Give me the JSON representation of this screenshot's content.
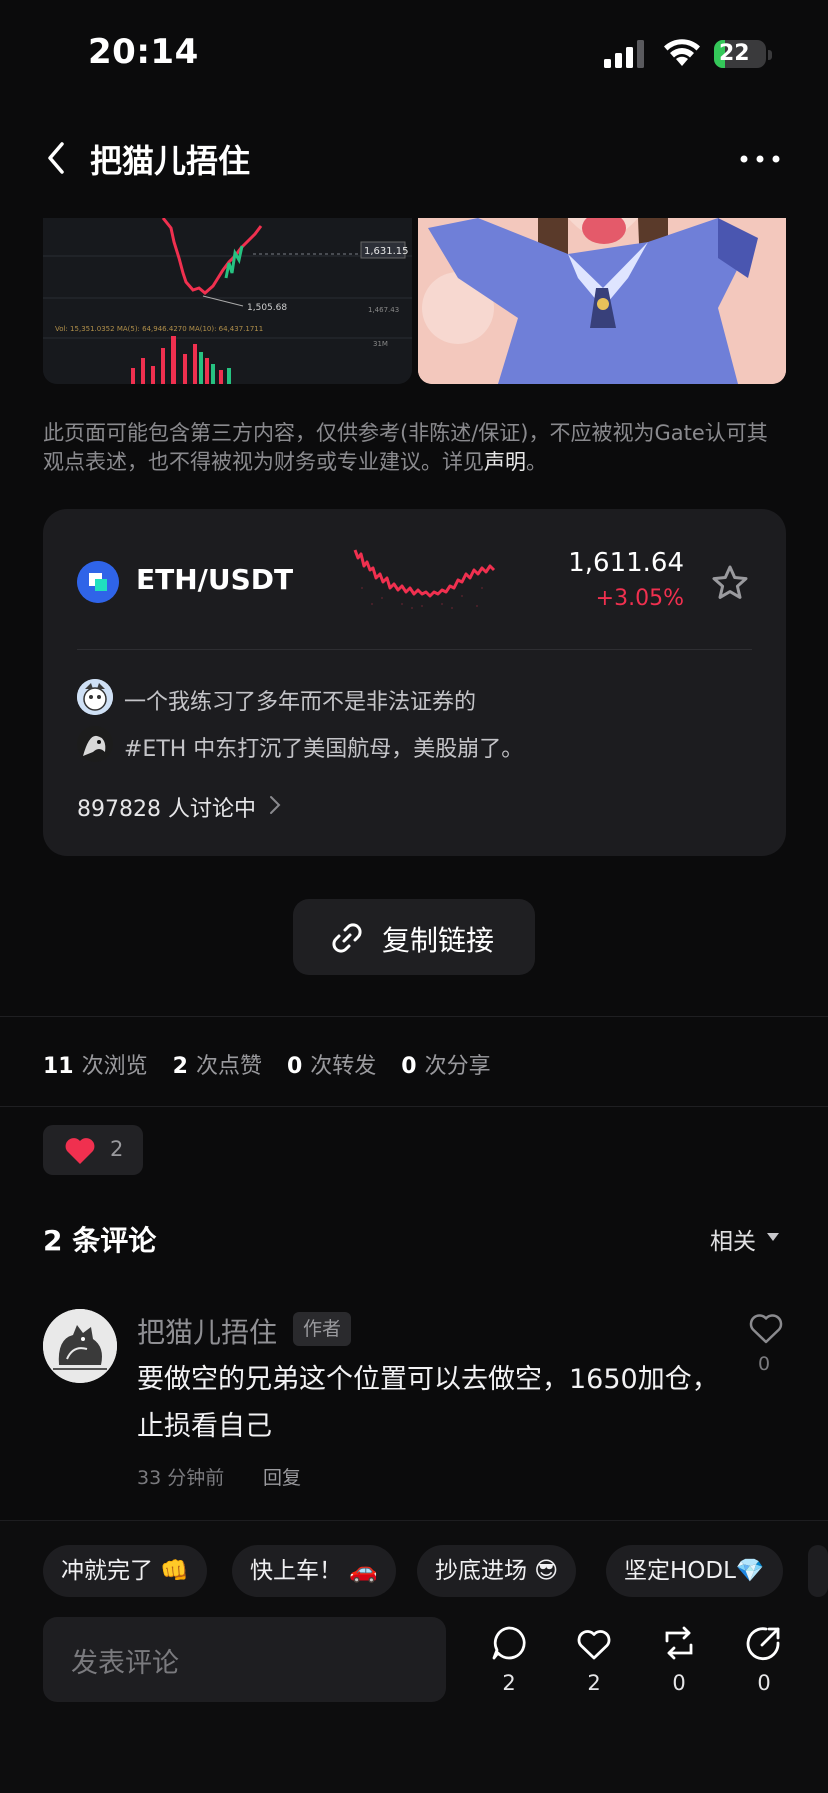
{
  "status_bar": {
    "time": "20:14",
    "battery_percent": "22",
    "battery_level": 0.22
  },
  "header": {
    "title": "把猫儿捂住"
  },
  "disclaimer": {
    "text": "此页面可能包含第三方内容，仅供参考(非陈述/保证)，不应被视为Gate认可其观点表述，也不得被视为财务或专业建议。详见",
    "link": "声明",
    "end": "。"
  },
  "chart_image": {
    "label_price": "1,631.15",
    "label_low": "1,505.68",
    "label_ma": "Vol: 15,351.0352  MA(5): 64,946.4270  MA(10): 64,437.1711"
  },
  "market": {
    "pair": "ETH/USDT",
    "price": "1,611.64",
    "change": "+3.05%",
    "discussions": [
      {
        "text": "一个我练习了多年而不是非法证券的"
      },
      {
        "text": "#ETH 中东打沉了美国航母，美股崩了。"
      }
    ],
    "discuss_count": "897828 人讨论中"
  },
  "copy_link": {
    "label": "复制链接"
  },
  "stats": [
    {
      "num": "11",
      "label": "次浏览"
    },
    {
      "num": "2",
      "label": "次点赞"
    },
    {
      "num": "0",
      "label": "次转发"
    },
    {
      "num": "0",
      "label": "次分享"
    }
  ],
  "reaction": {
    "count": "2"
  },
  "comments": {
    "title": "2 条评论",
    "sort": "相关",
    "items": [
      {
        "name": "把猫儿捂住",
        "tag": "作者",
        "body": "要做空的兄弟这个位置可以去做空，1650加仓，止损看自己",
        "time": "33 分钟前",
        "reply": "回复",
        "likes": "0"
      }
    ]
  },
  "quick_replies": [
    {
      "label": "冲就完了 👊"
    },
    {
      "label": "快上车！ 🚗"
    },
    {
      "label": "抄底进场 😎"
    },
    {
      "label": "坚定HODL💎"
    }
  ],
  "bottom_bar": {
    "placeholder": "发表评论",
    "comments_count": "2",
    "likes_count": "2",
    "reposts_count": "0",
    "shares_count": "0"
  },
  "colors": {
    "accent_red": "#f0304f",
    "coin_blue": "#2f64e8",
    "battery_green": "#34c759"
  }
}
